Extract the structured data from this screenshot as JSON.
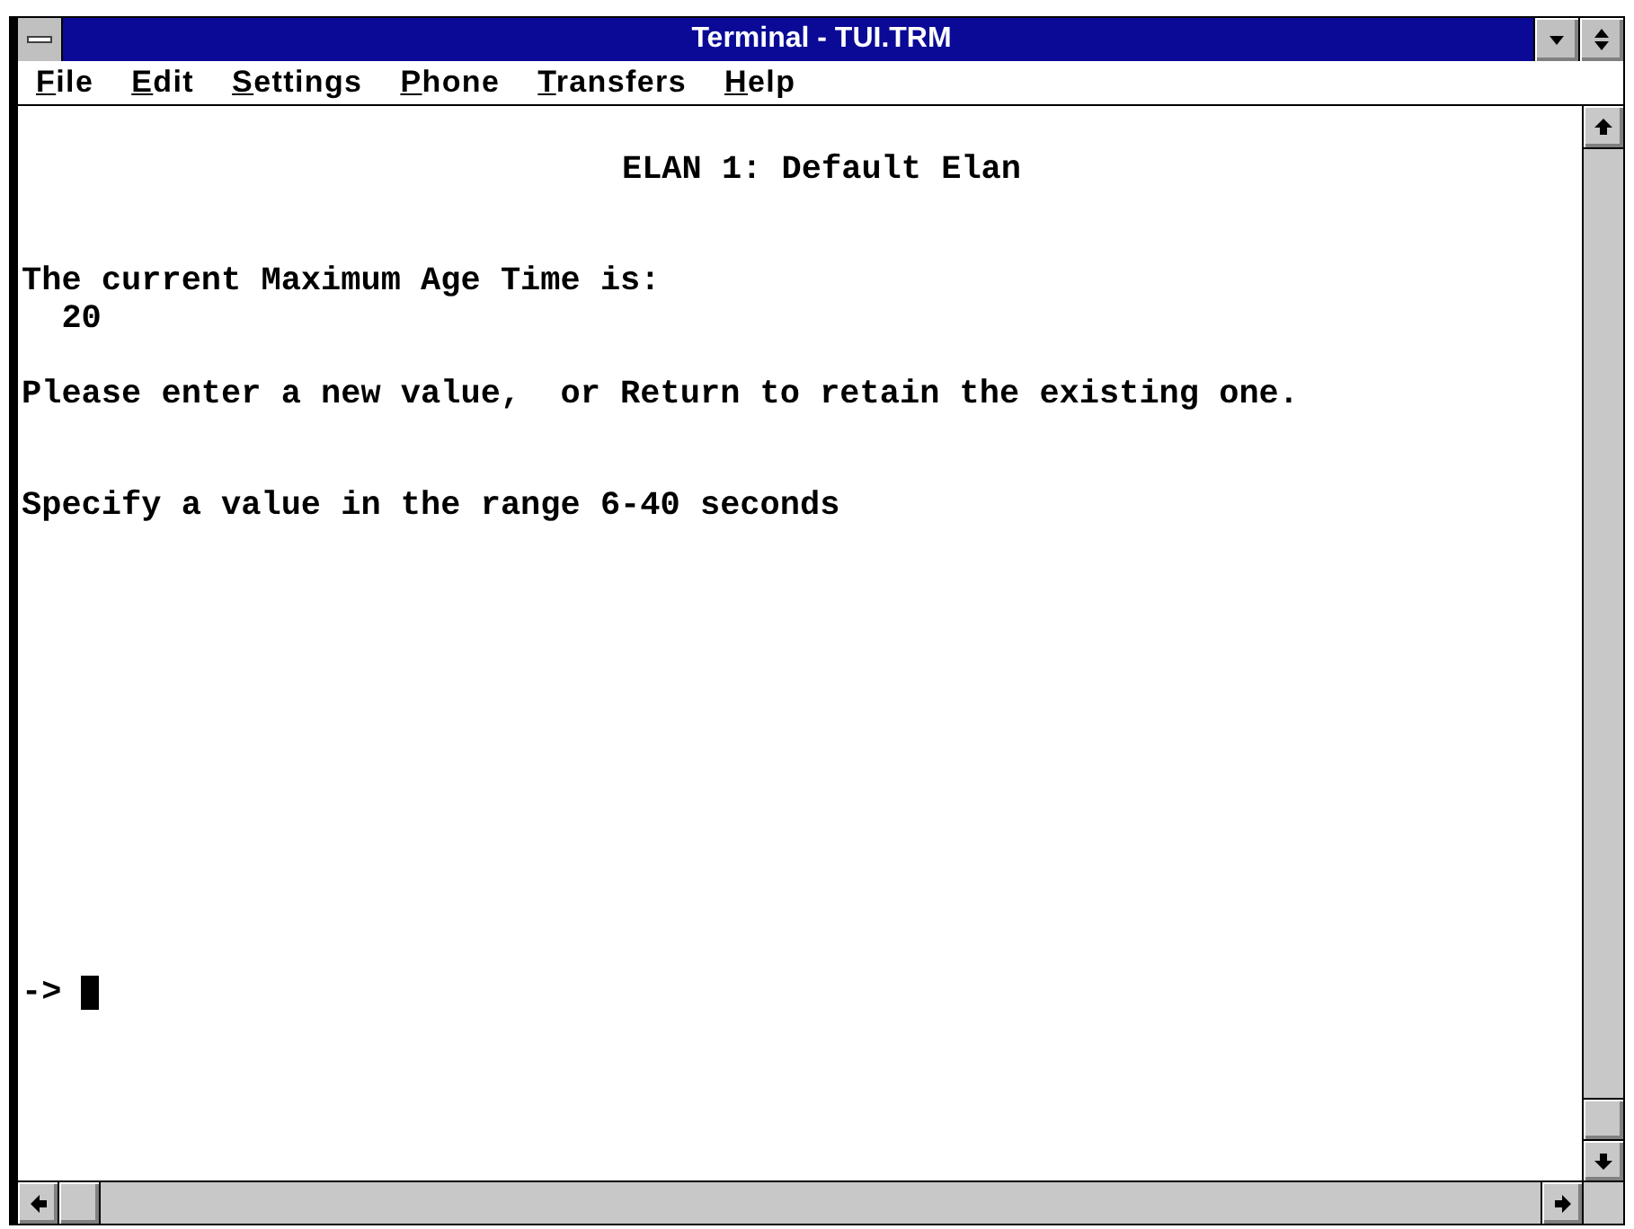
{
  "window": {
    "title": "Terminal - TUI.TRM"
  },
  "menu_bar": [
    "File",
    "Edit",
    "Settings",
    "Phone",
    "Transfers",
    "Help"
  ],
  "terminal": {
    "heading": "ELAN 1: Default Elan",
    "current_setting": {
      "label": "The current Maximum Age Time is:",
      "value": "20"
    },
    "instruction": "Please enter a new value,  or Return to retain the existing one.",
    "range_hint": "Specify a value in the range 6-40 seconds",
    "prompt": "->"
  }
}
